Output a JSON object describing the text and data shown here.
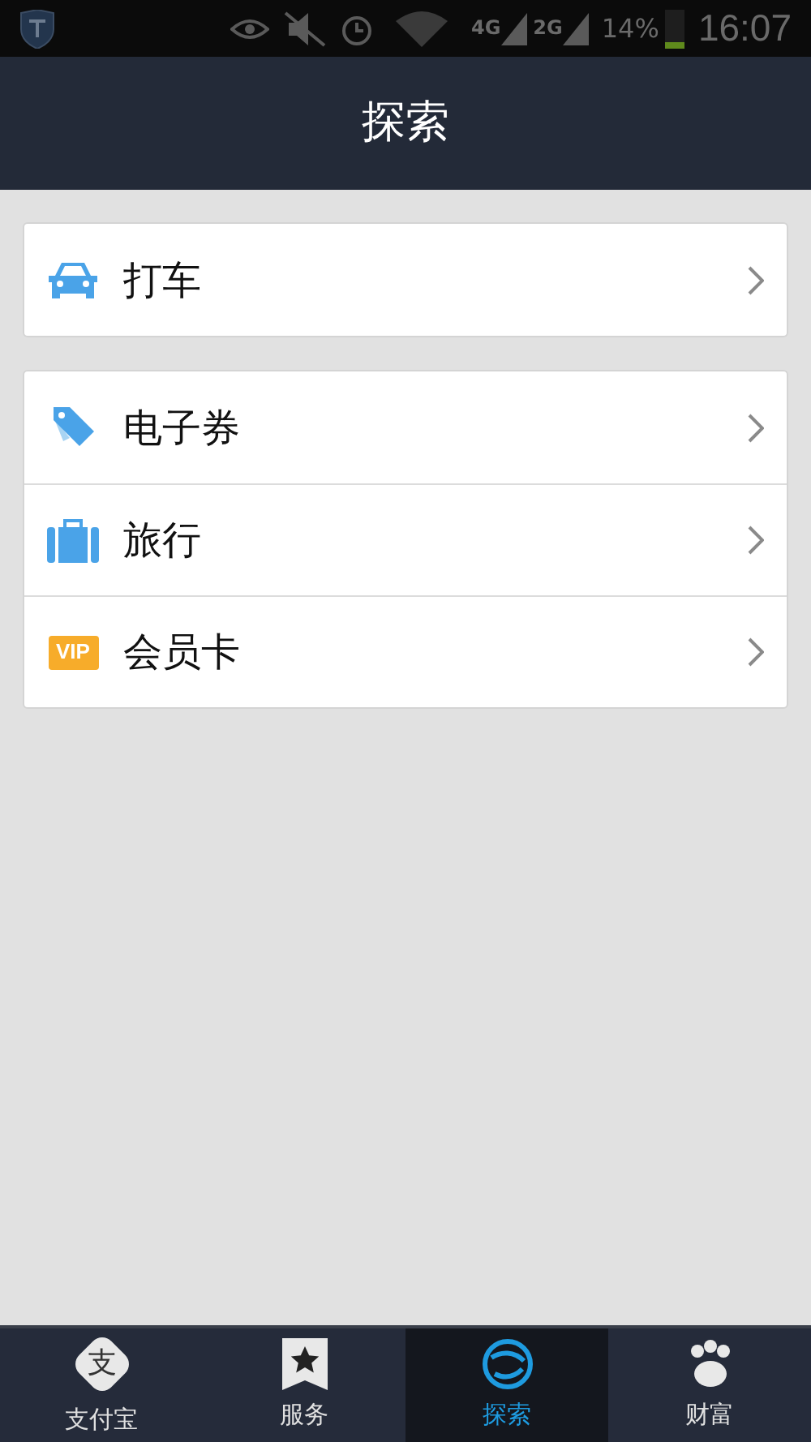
{
  "status_bar": {
    "signals": [
      {
        "label": "4G"
      },
      {
        "label": "2G"
      }
    ],
    "battery": "14%",
    "time": "16:07"
  },
  "header": {
    "title": "探索"
  },
  "groups": [
    {
      "items": [
        {
          "kind": "taxi",
          "label": "打车"
        }
      ]
    },
    {
      "items": [
        {
          "kind": "coupon",
          "label": "电子券"
        },
        {
          "kind": "travel",
          "label": "旅行"
        },
        {
          "kind": "vip",
          "label": "会员卡",
          "badge": "VIP"
        }
      ]
    }
  ],
  "tabs": [
    {
      "kind": "alipay",
      "label": "支付宝",
      "icon_text": "支",
      "selected": false
    },
    {
      "kind": "service",
      "label": "服务",
      "selected": false
    },
    {
      "kind": "explore",
      "label": "探索",
      "selected": true
    },
    {
      "kind": "wealth",
      "label": "财富",
      "selected": false
    }
  ]
}
